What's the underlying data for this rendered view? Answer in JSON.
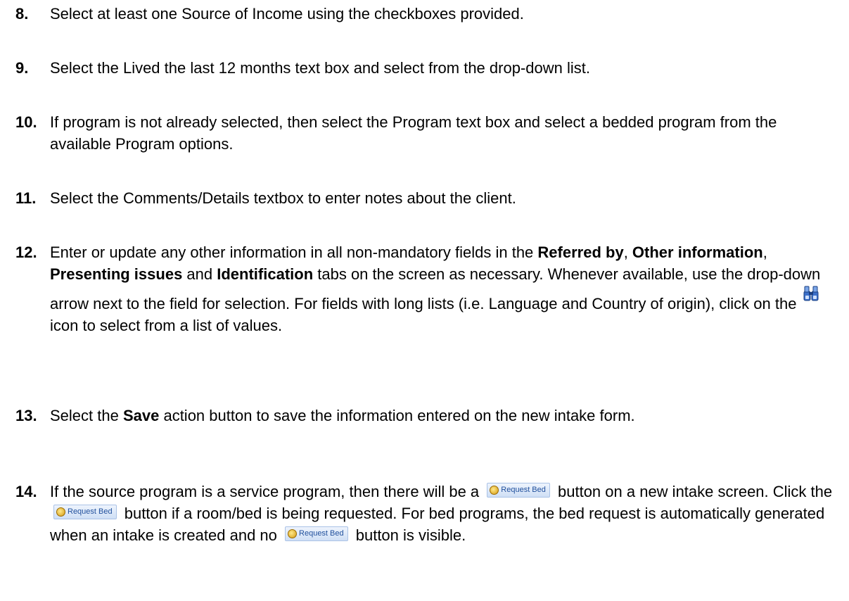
{
  "steps": [
    {
      "number": "8.",
      "text": "Select at least one Source of Income using the checkboxes provided."
    },
    {
      "number": "9.",
      "text": "Select the Lived the last 12 months text box and select from the drop-down list."
    },
    {
      "number": "10.",
      "text": "If program is not already selected, then select the Program text box and select a bedded program from the available Program options."
    },
    {
      "number": "11.",
      "text": "Select the Comments/Details textbox to enter notes about the client."
    },
    {
      "number": "12.",
      "t1": "Enter or update any other information in all non-mandatory fields in the ",
      "b1": "Referred by",
      "t2": ", ",
      "b2": "Other information",
      "t3": ", ",
      "b3": "Presenting issues",
      "t4": " and ",
      "b4": "Identification",
      "t5": " tabs on the screen as necessary.  Whenever available, use the drop-down arrow next to the field for selection.  For fields with long lists (i.e. Language and Country of origin), click on the ",
      "t6": " icon to select from a list of values.",
      "icon": "binoculars-icon"
    },
    {
      "number": "13.",
      "t1": "Select the ",
      "b1": "Save",
      "t2": " action button to save the information entered on the new intake form."
    },
    {
      "number": "14.",
      "t1": "If the source program is a service program, then there will be a ",
      "t2": " button on a new intake screen. Click the ",
      "t3": " button if a room/bed is being requested.  For bed programs, the bed request is automatically generated when an intake is created and no ",
      "t4": " button is visible."
    }
  ],
  "request_bed_button": {
    "label": "Request Bed",
    "icon": "bed-request-icon"
  },
  "colors": {
    "button_text": "#1f4f9c",
    "button_border": "#aac2e6"
  }
}
